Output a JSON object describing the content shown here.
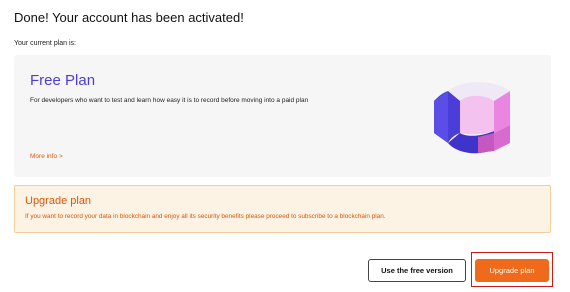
{
  "header": {
    "title": "Done! Your account has been activated!",
    "current_plan_label": "Your current plan is:"
  },
  "plan": {
    "name": "Free Plan",
    "description": "For developers who want to test and learn how easy it is to record before moving into a paid plan",
    "more_info": "More info >",
    "illustration_icon": "cube-ring-icon"
  },
  "upgrade": {
    "title": "Upgrade plan",
    "description": "If you want to record your data in blockchain and enjoy all its security benefits please proceed to subscribe to a blockchain plan."
  },
  "actions": {
    "free_label": "Use the free version",
    "upgrade_label": "Upgrade plan"
  },
  "colors": {
    "plan_name": "#4b3ed8",
    "accent_orange": "#f06a1b",
    "upgrade_bg": "#fdf3e4",
    "highlight_border": "#cc1a1a"
  }
}
